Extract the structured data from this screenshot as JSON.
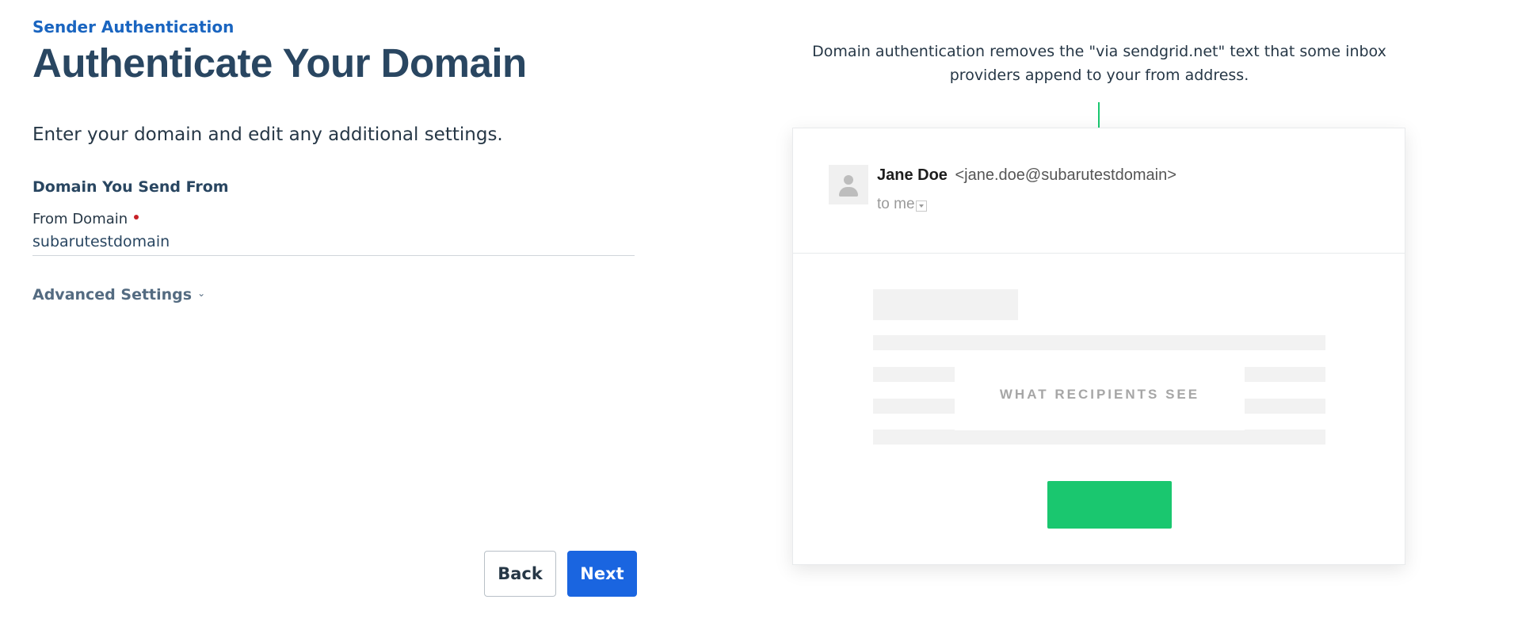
{
  "breadcrumb": "Sender Authentication",
  "page_title": "Authenticate Your Domain",
  "intro": "Enter your domain and edit any additional settings.",
  "section_heading": "Domain You Send From",
  "from_domain": {
    "label": "From Domain",
    "value": "subarutestdomain",
    "required": true
  },
  "advanced_settings": {
    "label": "Advanced Settings",
    "chevron_icon": "chevron-down-icon"
  },
  "buttons": {
    "back": "Back",
    "next": "Next"
  },
  "callout": "Domain authentication removes the \"via sendgrid.net\" text that some inbox providers append to your from address.",
  "preview": {
    "sender_name": "Jane Doe",
    "sender_email": "<jane.doe@subarutestdomain>",
    "to_label": "to me",
    "overlay_label": "WHAT RECIPIENTS SEE"
  },
  "colors": {
    "primary": "#1a65e0",
    "title": "#294661",
    "accent_green": "#1ac76f",
    "required": "#c72127"
  }
}
